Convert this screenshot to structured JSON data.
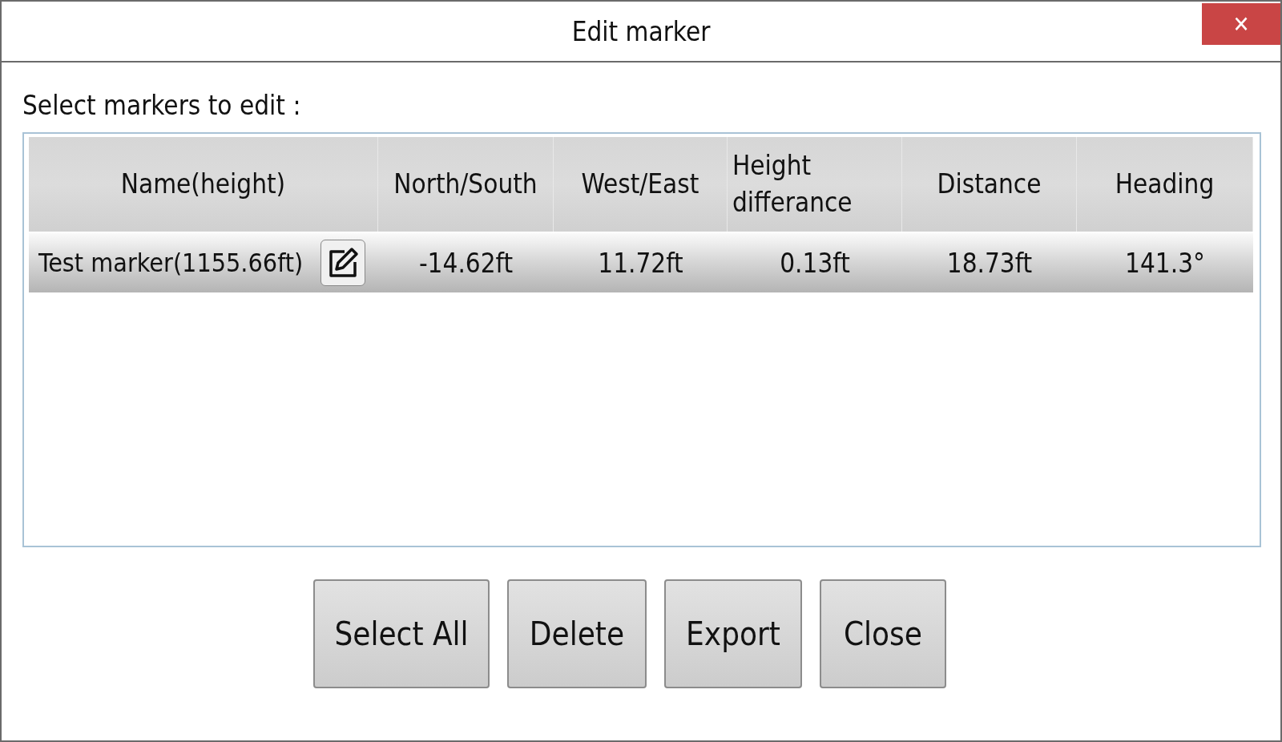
{
  "window": {
    "title": "Edit marker",
    "close": "✕"
  },
  "prompt": "Select markers to edit :",
  "table": {
    "columns": [
      "Name(height)",
      "North/South",
      "West/East",
      "Height differance",
      "Distance",
      "Heading"
    ],
    "rows": [
      {
        "selected": true,
        "cells": [
          "Test marker(1155.66ft)",
          "-14.62ft",
          "11.72ft",
          "0.13ft",
          "18.73ft",
          "141.3°"
        ]
      }
    ]
  },
  "buttons": [
    "Select All",
    "Delete",
    "Export",
    "Close"
  ]
}
